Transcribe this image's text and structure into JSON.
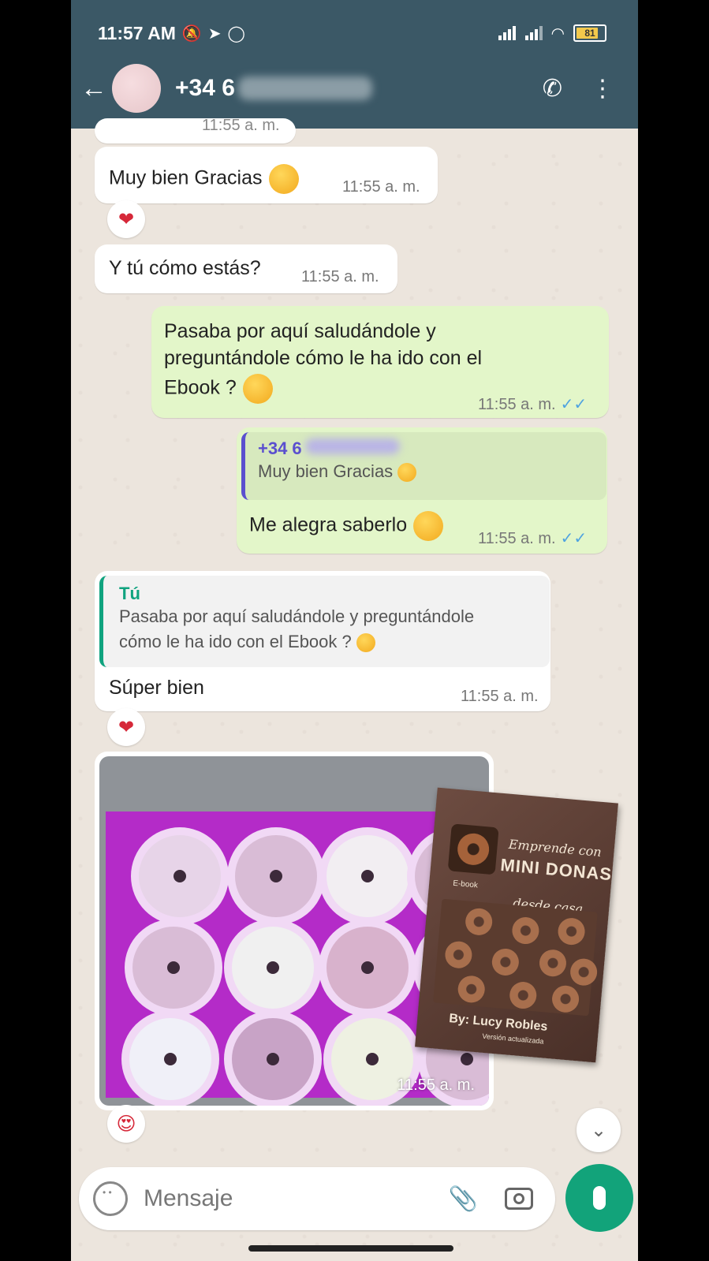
{
  "status": {
    "time": "11:57 AM",
    "battery": "81"
  },
  "header": {
    "contact": "+34 6"
  },
  "messages": {
    "prev_time": "11:55 a. m.",
    "m1": {
      "text": "Muy bien Gracias",
      "time": "11:55 a. m."
    },
    "m2": {
      "text": "Y tú cómo estás?",
      "time": "11:55 a. m."
    },
    "m3": {
      "line1": "Pasaba por aquí saludándole y",
      "line2": "preguntándole cómo le ha ido con el",
      "line3": "Ebook ?",
      "time": "11:55 a. m."
    },
    "m4": {
      "quote_name": "+34 6",
      "quote_text": "Muy bien Gracias",
      "text": "Me alegra saberlo",
      "time": "11:55 a. m."
    },
    "m5": {
      "quote_name": "Tú",
      "quote_line1": "Pasaba por aquí saludándole y preguntándole",
      "quote_line2": "cómo le ha ido con el Ebook ?",
      "text": "Súper bien",
      "time": "11:55 a. m."
    },
    "m6": {
      "time": "11:55 a. m."
    }
  },
  "ebook": {
    "line1": "Emprende con",
    "line2": "MINI DONAS",
    "line3": "desde casa",
    "tag": "E-book",
    "author": "By: Lucy Robles",
    "version": "Versión actualizada"
  },
  "composer": {
    "placeholder": "Mensaje"
  },
  "colors": {
    "header": "#3b5866",
    "outgoing": "#e3f6c9",
    "accent": "#12a37a",
    "ticks": "#4fa3e0"
  }
}
